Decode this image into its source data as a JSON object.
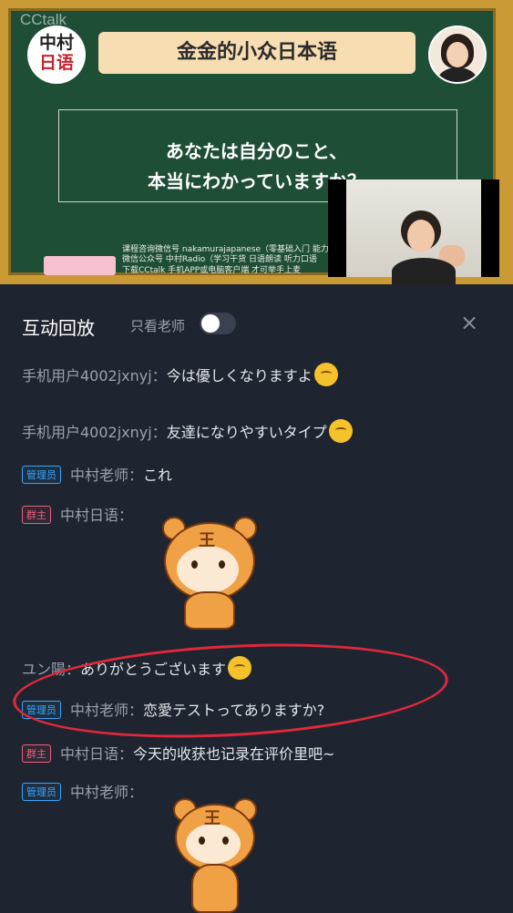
{
  "video": {
    "watermark": "CCtalk",
    "logo_line1": "中村",
    "logo_line2": "日语",
    "course_title": "金金的小众日本语",
    "question_line1": "あなたは自分のこと、",
    "question_line2": "本当にわかっていますか？",
    "info_line1": "课程咨询微信号 nakamurajapanese（零基础入门  能力",
    "info_line2": "微信公众号  中村Radio（学习干货  日语朗读  听力口语",
    "info_line3": "下载CCtalk  手机APP或电脑客户端    才可举手上麦"
  },
  "panel": {
    "title": "互动回放",
    "filter_label": "只看老师",
    "filter_toggle_on": false,
    "close_icon": "×"
  },
  "messages": [
    {
      "user": "手机用户4002jxnyj：",
      "text": "今は優しくなりますよ",
      "emoji": "grin-emoji"
    },
    {
      "user": "手机用户4002jxnyj：",
      "text": "友達になりやすいタイプ",
      "emoji": "shy-emoji"
    },
    {
      "badge": "管理员",
      "user": "中村老师：",
      "text": "これ"
    },
    {
      "badge": "群主",
      "user": "中村日语：",
      "text": "",
      "sticker": "tiger-sticker"
    },
    {
      "user": "ユン陽：",
      "text": "ありがとうございます",
      "emoji": "smile-emoji"
    },
    {
      "badge": "管理员",
      "user": "中村老师：",
      "text": "恋愛テストってありますか?"
    },
    {
      "badge": "群主",
      "user": "中村日语：",
      "text": "今天的收获也记录在评价里吧~"
    },
    {
      "badge": "管理员",
      "user": "中村老师：",
      "text": "",
      "sticker": "tiger-sticker"
    }
  ],
  "colors": {
    "board": "#1f4e36",
    "frame": "#c99a36",
    "panel_bg": "#1f2530",
    "admin_badge": "#34a6ff",
    "owner_badge": "#f05c7c",
    "annotation_circle": "#e0283c"
  }
}
